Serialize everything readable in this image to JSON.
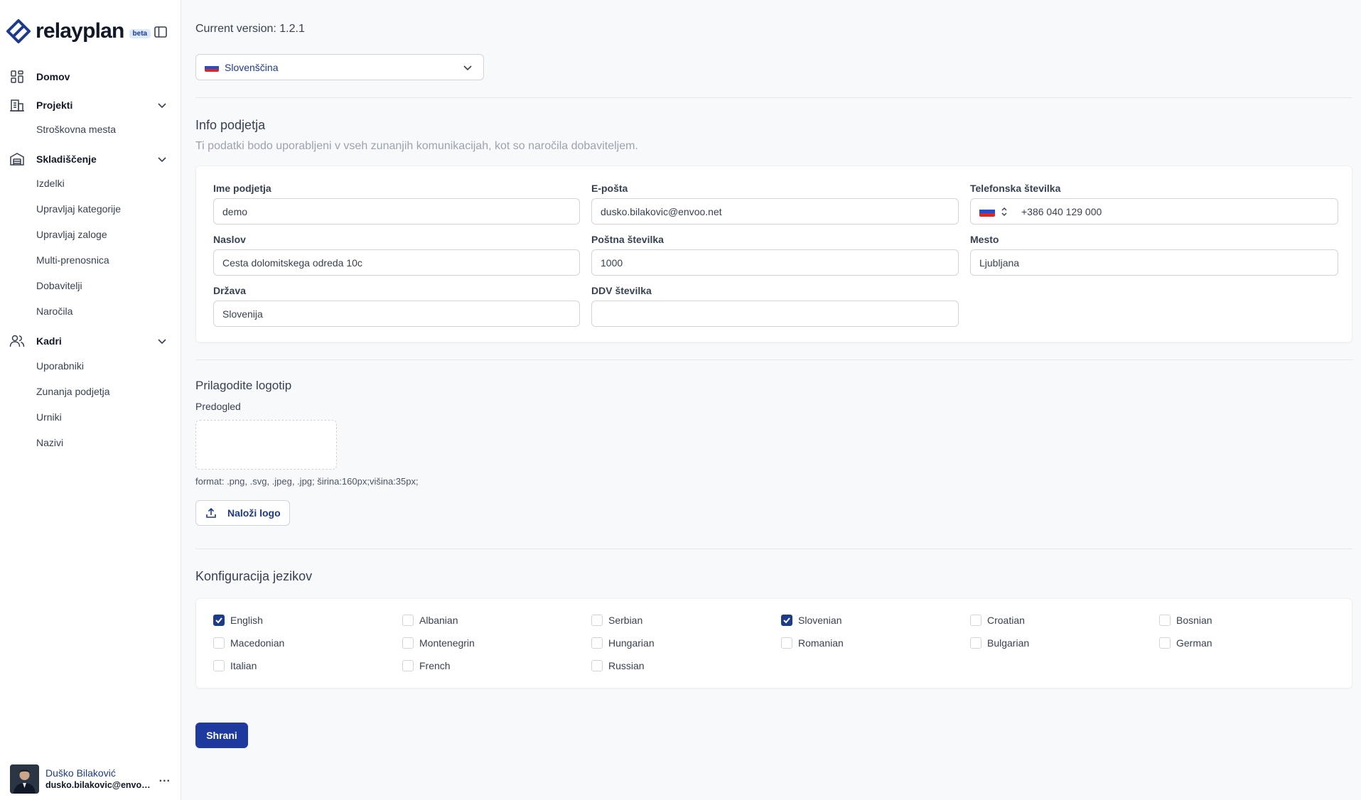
{
  "brand": {
    "name": "relayplan",
    "badge": "beta"
  },
  "sidebar": {
    "sections": [
      {
        "label": "Domov",
        "icon": "grid-icon"
      },
      {
        "label": "Projekti",
        "icon": "building-icon",
        "children": [
          "Stroškovna mesta"
        ]
      },
      {
        "label": "Skladiščenje",
        "icon": "warehouse-icon",
        "children": [
          "Izdelki",
          "Upravljaj kategorije",
          "Upravljaj zaloge",
          "Multi-prenosnica",
          "Dobavitelji",
          "Naročila"
        ]
      },
      {
        "label": "Kadri",
        "icon": "users-icon",
        "children": [
          "Uporabniki",
          "Zunanja podjetja",
          "Urniki",
          "Nazivi"
        ]
      }
    ]
  },
  "user": {
    "name": "Duško Bilaković",
    "email": "dusko.bilakovic@envoo.net",
    "menu": "..."
  },
  "main": {
    "version_text": "Current version: 1.2.1",
    "language": {
      "selected": "Slovenščina"
    },
    "company": {
      "title": "Info podjetja",
      "subtitle": "Ti podatki bodo uporabljeni v vseh zunanjih komunikacijah, kot so naročila dobaviteljem.",
      "fields": {
        "name": {
          "label": "Ime podjetja",
          "value": "demo"
        },
        "email": {
          "label": "E-pošta",
          "value": "dusko.bilakovic@envoo.net"
        },
        "phone": {
          "label": "Telefonska številka",
          "value": "+386 040 129 000"
        },
        "address": {
          "label": "Naslov",
          "value": "Cesta dolomitskega odreda 10c"
        },
        "postal": {
          "label": "Poštna številka",
          "value": "1000"
        },
        "city": {
          "label": "Mesto",
          "value": "Ljubljana"
        },
        "country": {
          "label": "Država",
          "value": "Slovenija"
        },
        "vat": {
          "label": "DDV številka",
          "value": ""
        }
      }
    },
    "logo": {
      "title": "Prilagodite logotip",
      "preview_label": "Predogled",
      "format_hint": "format: .png, .svg, .jpeg, .jpg; širina:160px;višina:35px;",
      "upload_label": "Naloži logo"
    },
    "languages": {
      "title": "Konfiguracija jezikov",
      "items": [
        {
          "name": "English",
          "checked": true
        },
        {
          "name": "Albanian",
          "checked": false
        },
        {
          "name": "Serbian",
          "checked": false
        },
        {
          "name": "Slovenian",
          "checked": true
        },
        {
          "name": "Croatian",
          "checked": false
        },
        {
          "name": "Bosnian",
          "checked": false
        },
        {
          "name": "Macedonian",
          "checked": false
        },
        {
          "name": "Montenegrin",
          "checked": false
        },
        {
          "name": "Hungarian",
          "checked": false
        },
        {
          "name": "Romanian",
          "checked": false
        },
        {
          "name": "Bulgarian",
          "checked": false
        },
        {
          "name": "German",
          "checked": false
        },
        {
          "name": "Italian",
          "checked": false
        },
        {
          "name": "French",
          "checked": false
        },
        {
          "name": "Russian",
          "checked": false
        }
      ]
    },
    "save_label": "Shrani"
  },
  "colors": {
    "primary": "#1e3a8a",
    "button": "#1e3a9e",
    "background": "#f8f9fb"
  }
}
